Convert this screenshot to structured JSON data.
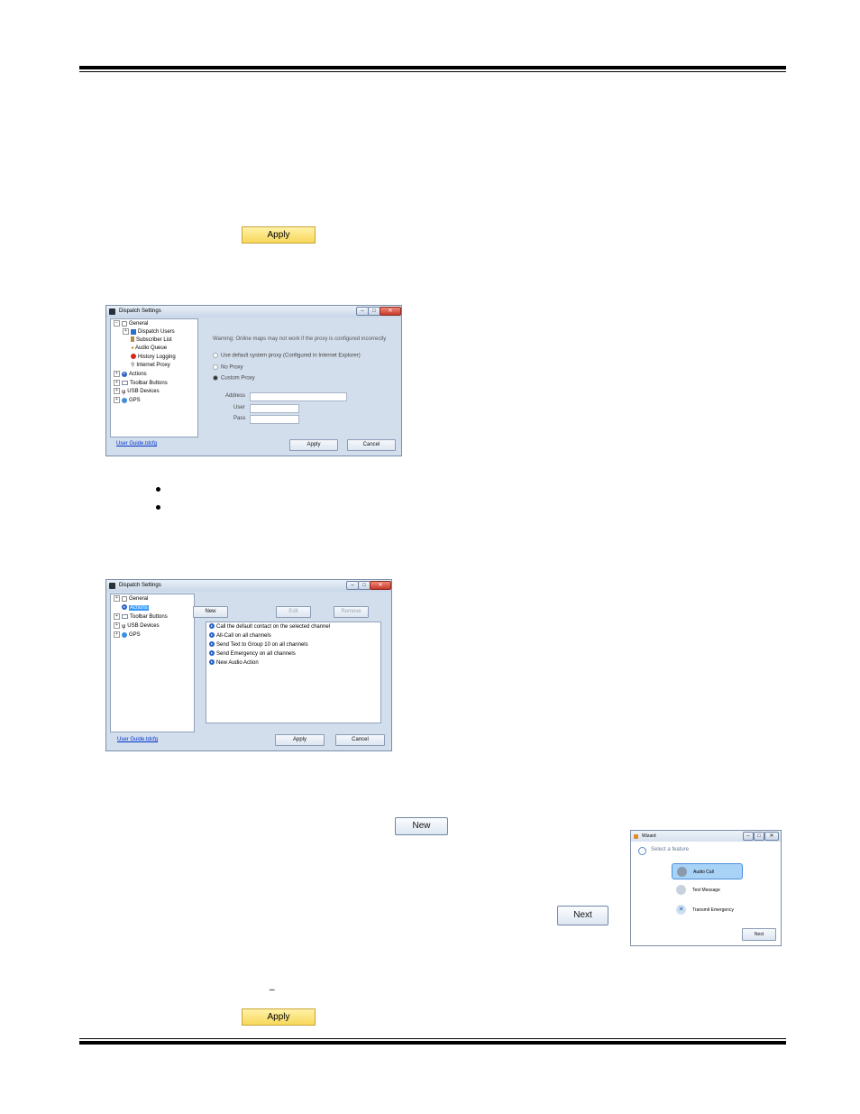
{
  "page": {
    "apply_label": "Apply",
    "new_label": "New",
    "next_label": "Next",
    "bullets": [
      "",
      ""
    ],
    "underscore": "_"
  },
  "proxy_dialog": {
    "title": "Dispatch Settings",
    "window_controls": [
      "–",
      "□",
      "✕"
    ],
    "tree": [
      {
        "label": "General",
        "icon": "settings-icon"
      },
      {
        "label": "Dispatch Users",
        "icon": "monitor-icon"
      },
      {
        "label": "Subscriber List",
        "icon": "list-icon"
      },
      {
        "label": "Audio Queue",
        "icon": "speaker-icon"
      },
      {
        "label": "History Logging",
        "icon": "record-icon"
      },
      {
        "label": "Internet Proxy",
        "icon": "proxy-icon"
      },
      {
        "label": "Actions",
        "icon": "arrow-icon"
      },
      {
        "label": "Toolbar Buttons",
        "icon": "toolbar-icon"
      },
      {
        "label": "USB Devices",
        "icon": "usb-icon"
      },
      {
        "label": "GPS",
        "icon": "globe-icon"
      }
    ],
    "warning": "Warning:  Online maps may not work if the proxy is configured incorrectly",
    "options": [
      {
        "label": "Use default system proxy  (Configured in Internet Explorer)",
        "selected": false
      },
      {
        "label": "No Proxy",
        "selected": false
      },
      {
        "label": "Custom Proxy",
        "selected": true
      }
    ],
    "fields": {
      "address": "Address",
      "user": "User",
      "pass": "Pass"
    },
    "user_guide": "User Guide.tdcfg",
    "apply": "Apply",
    "cancel": "Cancel"
  },
  "actions_dialog": {
    "title": "Dispatch Settings",
    "window_controls": [
      "–",
      "□",
      "✕"
    ],
    "tree": [
      {
        "label": "General"
      },
      {
        "label": "Actions",
        "selected": true
      },
      {
        "label": "Toolbar Buttons"
      },
      {
        "label": "USB Devices"
      },
      {
        "label": "GPS"
      }
    ],
    "buttons": {
      "new": "New",
      "edit": "Edit",
      "remove": "Remove"
    },
    "actions": [
      "Call the default contact on the selected channel",
      "All-Call on all channels",
      "Send Text to Group 10 on all channels",
      "Send Emergency on all channels",
      "New Audio Action"
    ],
    "user_guide": "User Guide.tdcfg",
    "apply": "Apply",
    "cancel": "Cancel"
  },
  "wizard": {
    "title": "Wizard",
    "window_controls": [
      "–",
      "□",
      "✕"
    ],
    "prompt": "Select a feature",
    "features": [
      {
        "label": "Audio Call",
        "selected": true
      },
      {
        "label": "Text Message",
        "selected": false
      },
      {
        "label": "Transmit Emergency",
        "selected": false
      }
    ],
    "next": "Next"
  }
}
